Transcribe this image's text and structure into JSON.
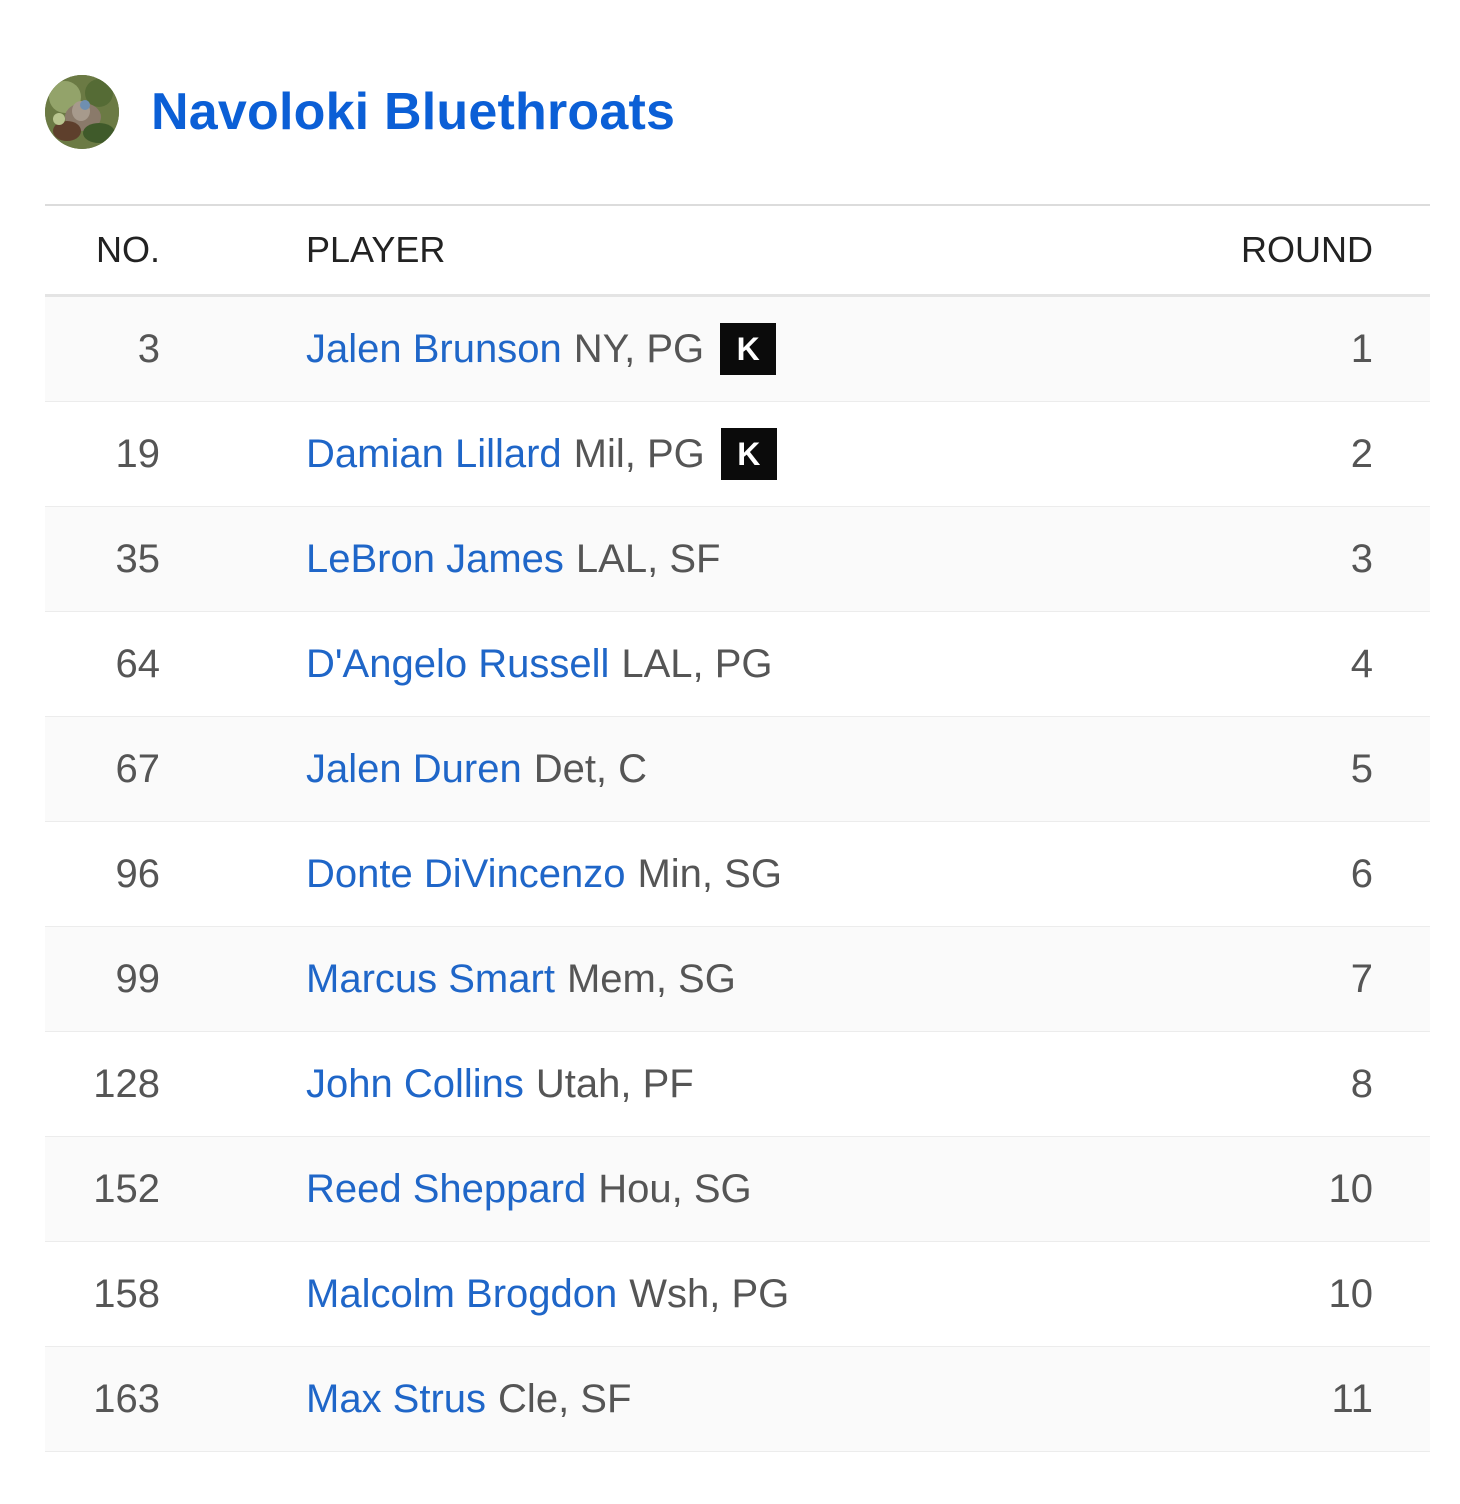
{
  "team": {
    "name": "Navoloki Bluethroats",
    "avatar_icon": "team-avatar-photo"
  },
  "table": {
    "headers": {
      "no": "NO.",
      "player": "PLAYER",
      "round": "ROUND"
    },
    "rows": [
      {
        "no": "3",
        "name": "Jalen Brunson",
        "meta": "NY, PG",
        "badge": "K",
        "round": "1"
      },
      {
        "no": "19",
        "name": "Damian Lillard",
        "meta": "Mil, PG",
        "badge": "K",
        "round": "2"
      },
      {
        "no": "35",
        "name": "LeBron James",
        "meta": "LAL, SF",
        "badge": null,
        "round": "3"
      },
      {
        "no": "64",
        "name": "D'Angelo Russell",
        "meta": "LAL, PG",
        "badge": null,
        "round": "4"
      },
      {
        "no": "67",
        "name": "Jalen Duren",
        "meta": "Det, C",
        "badge": null,
        "round": "5"
      },
      {
        "no": "96",
        "name": "Donte DiVincenzo",
        "meta": "Min, SG",
        "badge": null,
        "round": "6"
      },
      {
        "no": "99",
        "name": "Marcus Smart",
        "meta": "Mem, SG",
        "badge": null,
        "round": "7"
      },
      {
        "no": "128",
        "name": "John Collins",
        "meta": "Utah, PF",
        "badge": null,
        "round": "8"
      },
      {
        "no": "152",
        "name": "Reed Sheppard",
        "meta": "Hou, SG",
        "badge": null,
        "round": "10"
      },
      {
        "no": "158",
        "name": "Malcolm Brogdon",
        "meta": "Wsh, PG",
        "badge": null,
        "round": "10"
      },
      {
        "no": "163",
        "name": "Max Strus",
        "meta": "Cle, SF",
        "badge": null,
        "round": "11"
      }
    ]
  },
  "colors": {
    "team_name": "#0b5fd6",
    "player_link": "#1f66c8",
    "badge_bg": "#0b0b0b"
  }
}
